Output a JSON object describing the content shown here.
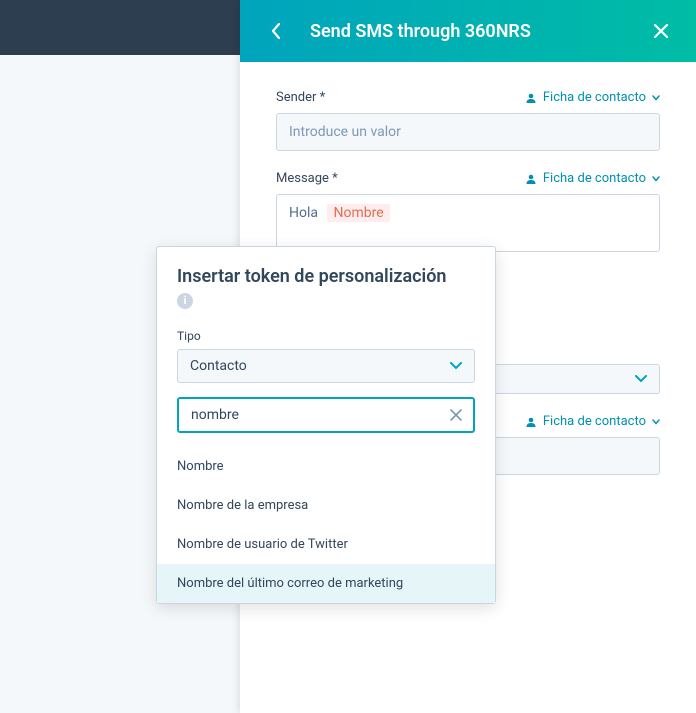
{
  "colors": {
    "teal": "#00a4bd",
    "darkTeal": "#0091ae",
    "text": "#33475b"
  },
  "header": {
    "title": "Send SMS through 360NRS"
  },
  "fields": {
    "sender": {
      "label": "Sender *",
      "placeholder": "Introduce un valor",
      "token_link": "Ficha de contacto"
    },
    "message": {
      "label": "Message *",
      "token_link": "Ficha de contacto",
      "text": "Hola",
      "token": "Nombre"
    },
    "extra_token_link": "Ficha de contacto"
  },
  "token_popup": {
    "title": "Insertar token de personalización",
    "type_label": "Tipo",
    "type_value": "Contacto",
    "search_value": "nombre",
    "results": [
      "Nombre",
      "Nombre de la empresa",
      "Nombre de usuario de Twitter",
      "Nombre del último correo de marketing"
    ],
    "active_index": 3
  }
}
